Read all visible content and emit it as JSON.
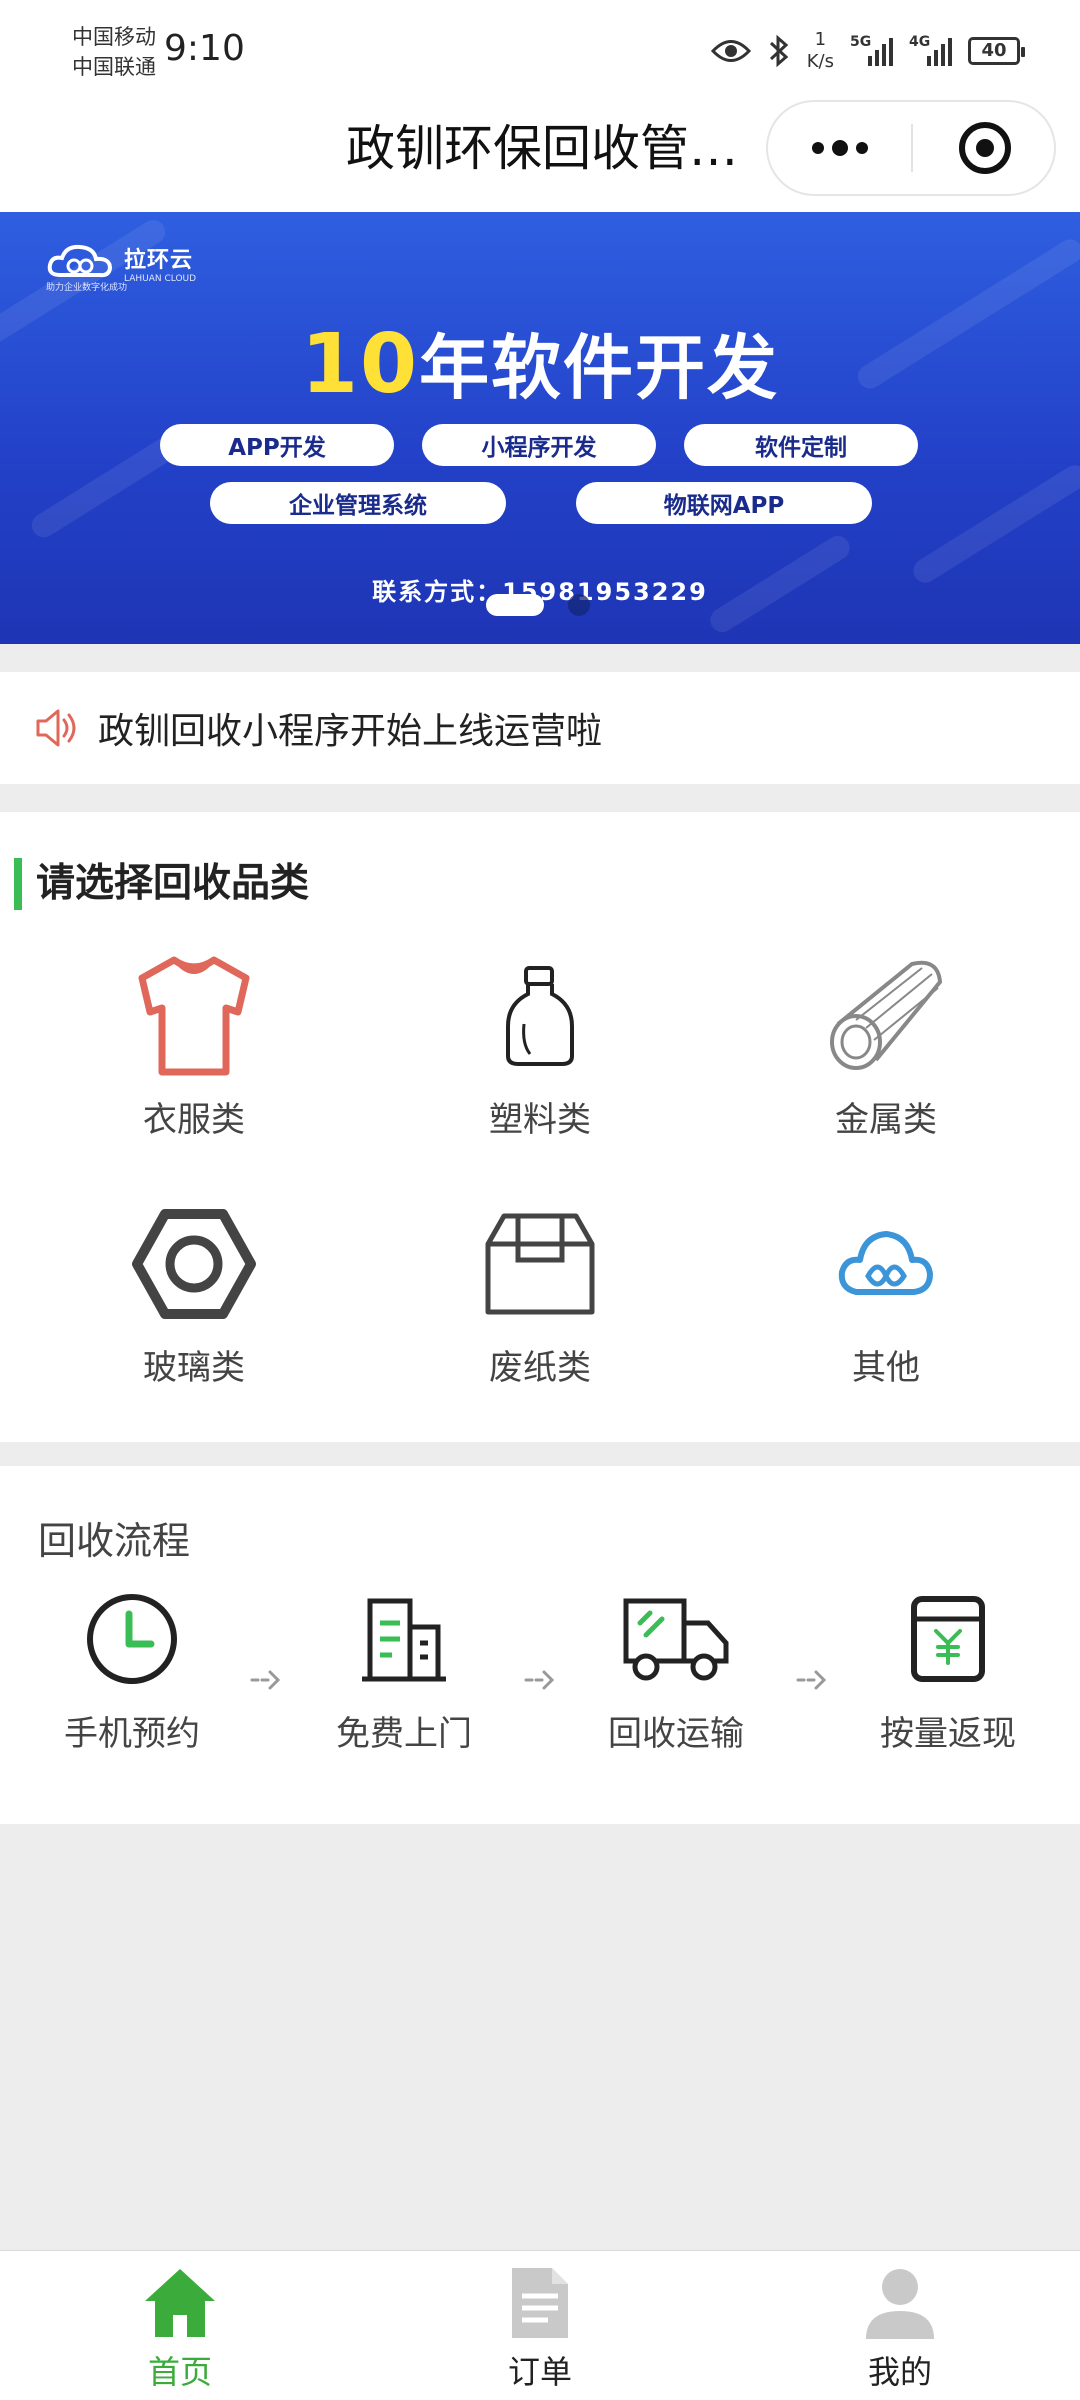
{
  "status_bar": {
    "carrier_1": "中国移动",
    "carrier_2": "中国联通",
    "time": "9:10",
    "net_speed_value": "1",
    "net_speed_unit": "K/s",
    "signal_1_label": "5G",
    "signal_2_label": "4G",
    "battery": "40"
  },
  "nav": {
    "title": "政钏环保回收管理系统",
    "more_icon": "more-dots-icon",
    "close_icon": "target-close-icon"
  },
  "banner": {
    "brand_name": "拉环云",
    "brand_sub": "LAHUAN CLOUD",
    "brand_tag": "助力企业数字化成功",
    "headline_number": "10",
    "headline_text": "年软件开发",
    "services": [
      "APP开发",
      "小程序开发",
      "软件定制",
      "企业管理系统",
      "物联网APP"
    ],
    "contact": "联系方式：15981953229",
    "slides_total": 2,
    "active_slide": 1
  },
  "notice": {
    "icon": "speaker-icon",
    "text": "政钏回收小程序开始上线运营啦"
  },
  "categories": {
    "title": "请选择回收品类",
    "items": [
      {
        "label": "衣服类",
        "icon": "shirt-icon"
      },
      {
        "label": "塑料类",
        "icon": "bottle-icon"
      },
      {
        "label": "金属类",
        "icon": "metal-pipe-icon"
      },
      {
        "label": "玻璃类",
        "icon": "hex-nut-icon"
      },
      {
        "label": "废纸类",
        "icon": "box-icon"
      },
      {
        "label": "其他",
        "icon": "cloud-icon"
      }
    ]
  },
  "process": {
    "title": "回收流程",
    "steps": [
      {
        "label": "手机预约",
        "icon": "clock-icon"
      },
      {
        "label": "免费上门",
        "icon": "building-icon"
      },
      {
        "label": "回收运输",
        "icon": "truck-icon"
      },
      {
        "label": "按量返现",
        "icon": "yuan-wallet-icon"
      }
    ]
  },
  "tabbar": {
    "items": [
      {
        "label": "首页",
        "icon": "home-icon",
        "active": true
      },
      {
        "label": "订单",
        "icon": "document-icon",
        "active": false
      },
      {
        "label": "我的",
        "icon": "user-icon",
        "active": false
      }
    ],
    "active_color": "#3bab3b",
    "inactive_color": "#222222"
  },
  "colors": {
    "accent_green": "#3bbd55",
    "banner_blue": "#2342c9",
    "highlight_yellow": "#ffe037",
    "shirt_red": "#e0685a",
    "cloud_blue": "#3b95d8"
  }
}
